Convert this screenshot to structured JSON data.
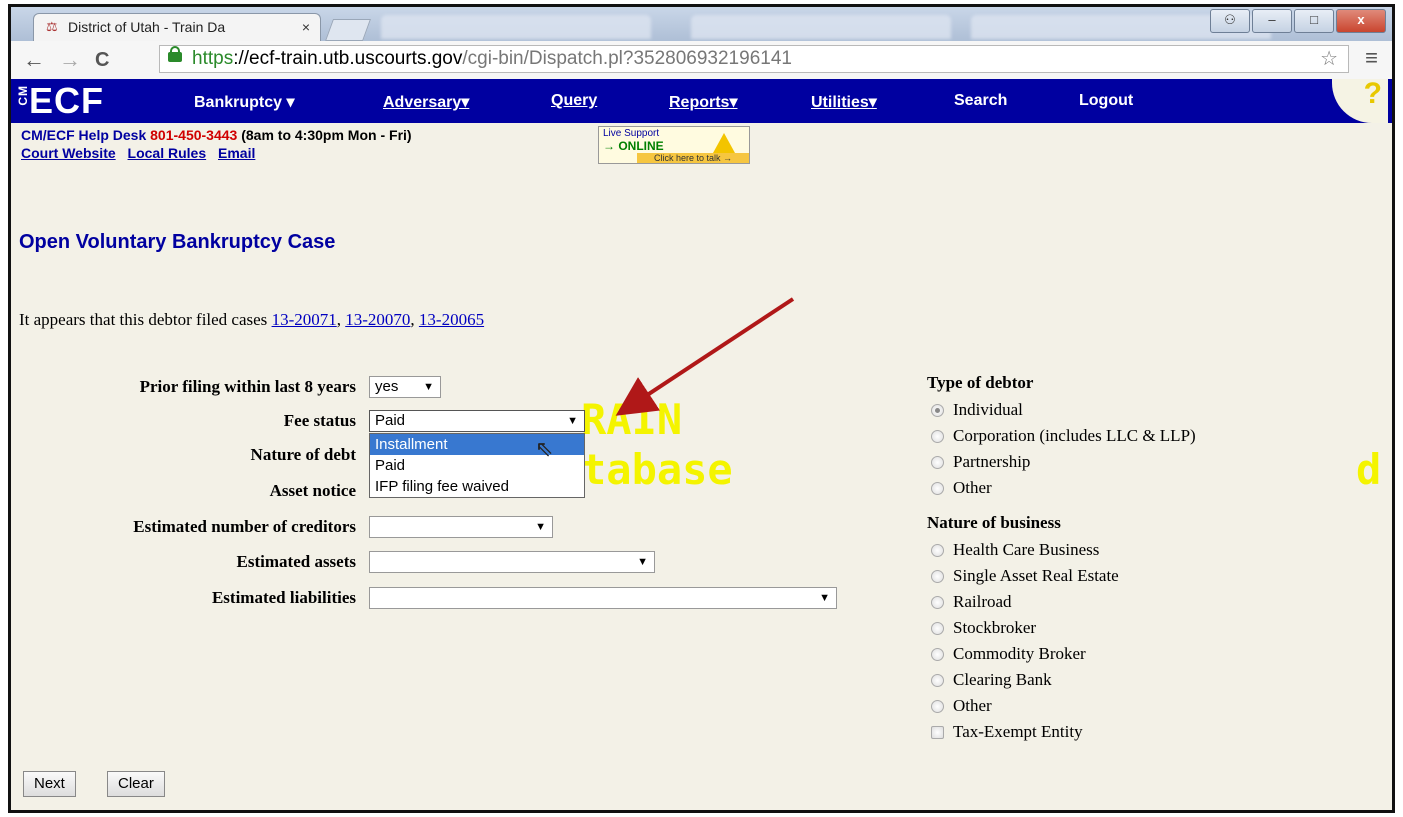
{
  "browser": {
    "tab_title": "District of Utah - Train Da",
    "tab_close": "×",
    "url_https": "https",
    "url_host": "://ecf-train.utb.uscourts.gov",
    "url_path": "/cgi-bin/Dispatch.pl?352806932196141",
    "back": "←",
    "forward": "→",
    "reload": "C",
    "star": "☆",
    "menu": "≡",
    "win_min": "–",
    "win_max": "□",
    "win_close": "x"
  },
  "ecf_nav": {
    "logo": "ECF",
    "logo_cm": "CM",
    "items": [
      "Bankruptcy ▾",
      "Adversary▾",
      "Query",
      "Reports▾",
      "Utilities▾",
      "Search",
      "Logout"
    ],
    "help": "?"
  },
  "helpdesk": {
    "label": "CM/ECF Help Desk",
    "phone": "801-450-3443",
    "hours": "(8am to 4:30pm Mon - Fri)",
    "links": [
      "Court Website",
      "Local Rules",
      "Email"
    ]
  },
  "live_support": {
    "line1": "Live Support",
    "line2": "→ ONLINE",
    "line3": "Click here to talk →"
  },
  "page_title": "Open Voluntary Bankruptcy Case",
  "appears": {
    "text": "It appears that this debtor filed cases",
    "cases": [
      "13-20071",
      "13-20070",
      "13-20065"
    ]
  },
  "form": {
    "prior_filing_label": "Prior filing within last 8 years",
    "prior_filing_value": "yes",
    "fee_status_label": "Fee status",
    "fee_status_value": "Paid",
    "fee_status_options": [
      "Installment",
      "Paid",
      "IFP filing fee waived"
    ],
    "nature_of_debt_label": "Nature of debt",
    "asset_notice_label": "Asset notice",
    "creditors_label": "Estimated number of creditors",
    "assets_label": "Estimated assets",
    "liabilities_label": "Estimated liabilities"
  },
  "watermark": {
    "line1": "RAIN",
    "line2": "tabase",
    "edge": "d"
  },
  "type_of_debtor": {
    "heading": "Type of debtor",
    "options": [
      "Individual",
      "Corporation (includes LLC & LLP)",
      "Partnership",
      "Other"
    ],
    "selected": "Individual"
  },
  "nature_of_business": {
    "heading": "Nature of business",
    "options": [
      "Health Care Business",
      "Single Asset Real Estate",
      "Railroad",
      "Stockbroker",
      "Commodity Broker",
      "Clearing Bank",
      "Other"
    ],
    "checkbox": "Tax-Exempt Entity"
  },
  "buttons": {
    "next": "Next",
    "clear": "Clear"
  },
  "colors": {
    "ecf_blue": "#0000a0",
    "annotation_arrow": "#b01818",
    "watermark": "#f4f400"
  }
}
